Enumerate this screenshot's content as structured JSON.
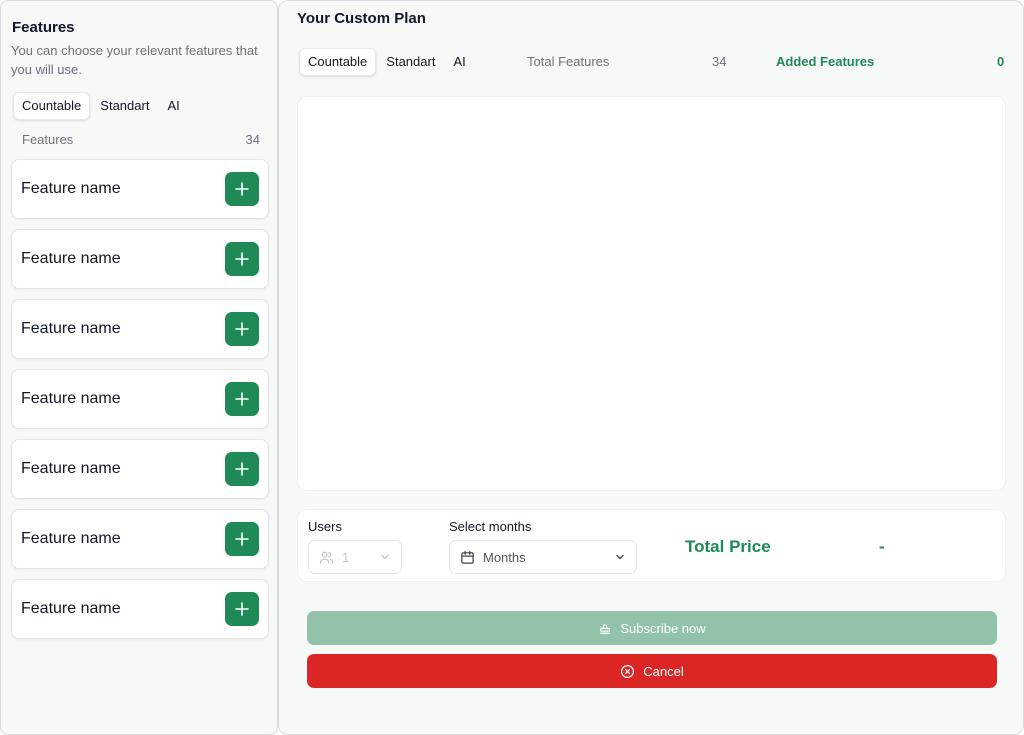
{
  "sidebar": {
    "title": "Features",
    "description": "You can choose your relevant features that you will use.",
    "tabs": [
      {
        "label": "Countable"
      },
      {
        "label": "Standart"
      },
      {
        "label": "AI"
      }
    ],
    "features_label": "Features",
    "features_count": "34",
    "features": [
      {
        "name": "Feature name"
      },
      {
        "name": "Feature name"
      },
      {
        "name": "Feature name"
      },
      {
        "name": "Feature name"
      },
      {
        "name": "Feature name"
      },
      {
        "name": "Feature name"
      },
      {
        "name": "Feature name"
      }
    ]
  },
  "plan": {
    "title": "Your Custom Plan",
    "tabs": [
      {
        "label": "Countable"
      },
      {
        "label": "Standart"
      },
      {
        "label": "AI"
      }
    ],
    "total_features_label": "Total Features",
    "total_features_value": "34",
    "added_features_label": "Added Features",
    "added_features_value": "0",
    "users_label": "Users",
    "users_value": "1",
    "months_label": "Select months",
    "months_placeholder": "Months",
    "total_price_label": "Total Price",
    "total_price_value": "-",
    "subscribe_label": "Subscribe now",
    "cancel_label": "Cancel"
  },
  "colors": {
    "accent": "#1f8a56",
    "accent_disabled": "#92c2aa",
    "danger": "#dc2626"
  }
}
